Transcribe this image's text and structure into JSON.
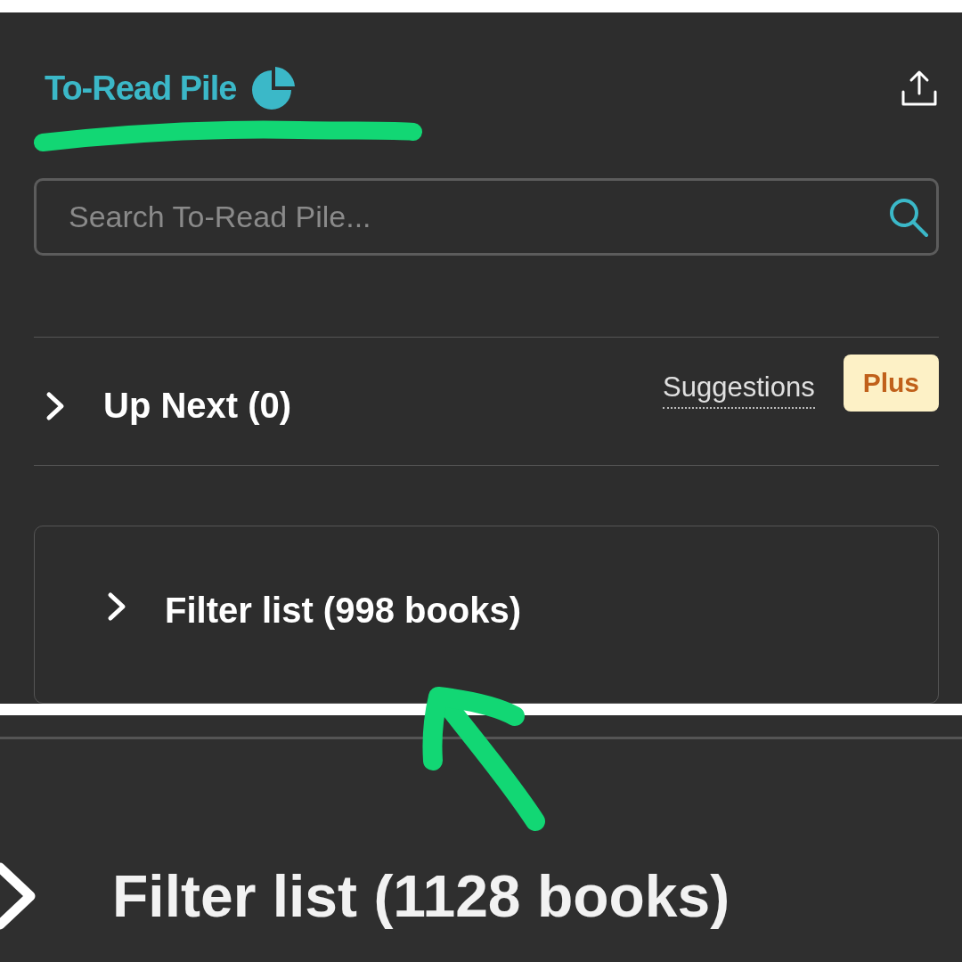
{
  "header": {
    "title": "To-Read Pile"
  },
  "search": {
    "placeholder": "Search To-Read Pile..."
  },
  "up_next": {
    "label": "Up Next (0)",
    "expanded": false,
    "suggestions": "Suggestions",
    "badge": "Plus"
  },
  "filter": {
    "label": "Filter list (998 books)",
    "expanded": false
  },
  "zoomed_filter": {
    "label": "Filter list (1128 books)",
    "expanded": false
  }
}
